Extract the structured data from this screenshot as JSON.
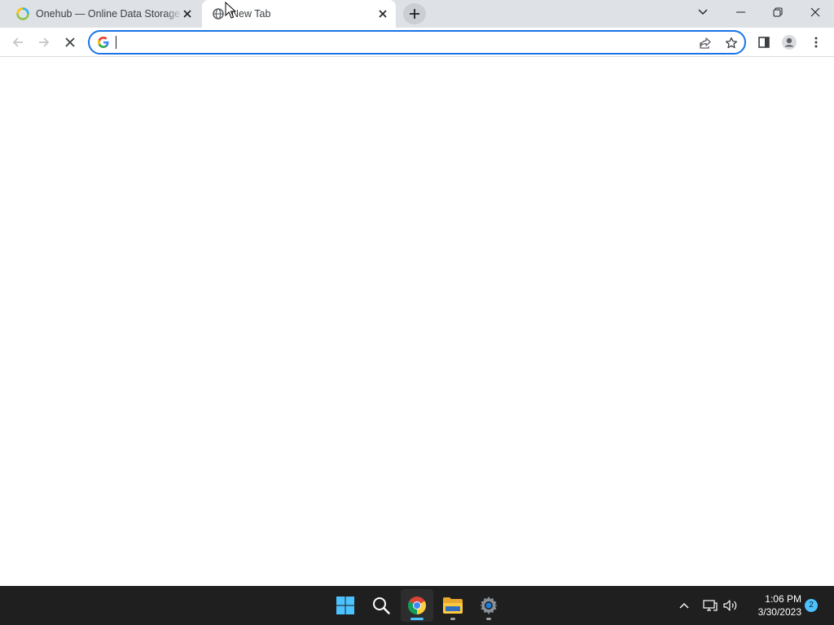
{
  "browser": {
    "tabs": [
      {
        "title": "Onehub — Online Data Storage -",
        "active": false,
        "favicon": "onehub-icon"
      },
      {
        "title": "New Tab",
        "active": true,
        "favicon": "loading-globe-icon"
      }
    ],
    "new_tab_icon": "plus-icon",
    "window_controls": [
      "tab-search-icon",
      "minimize-icon",
      "restore-icon",
      "close-icon"
    ],
    "toolbar": {
      "back_icon": "back-arrow-icon",
      "forward_icon": "forward-arrow-icon",
      "stop_icon": "stop-loading-icon",
      "omnibox": {
        "value": "",
        "placeholder": "",
        "engine_icon": "google-g-icon",
        "share_icon": "share-icon",
        "bookmark_icon": "star-icon"
      },
      "side_panel_icon": "side-panel-icon",
      "profile_icon": "profile-avatar-icon",
      "menu_icon": "kebab-menu-icon"
    }
  },
  "taskbar": {
    "apps": [
      {
        "name": "Start",
        "icon": "windows-start-icon"
      },
      {
        "name": "Search",
        "icon": "search-icon"
      },
      {
        "name": "Google Chrome",
        "icon": "chrome-icon",
        "active": true
      },
      {
        "name": "File Explorer",
        "icon": "folder-icon",
        "running": true
      },
      {
        "name": "Settings",
        "icon": "settings-gear-icon",
        "running": true
      }
    ],
    "tray": {
      "overflow_icon": "chevron-up-icon",
      "network_icon": "network-icon",
      "volume_icon": "volume-icon",
      "time": "1:06 PM",
      "date": "3/30/2023",
      "notification_count": "2"
    }
  },
  "colors": {
    "tabstrip_bg": "#dee1e6",
    "omnibox_focus": "#1a73e8",
    "taskbar_bg": "#1f1f1f",
    "accent_indicator": "#4cc2ff"
  }
}
